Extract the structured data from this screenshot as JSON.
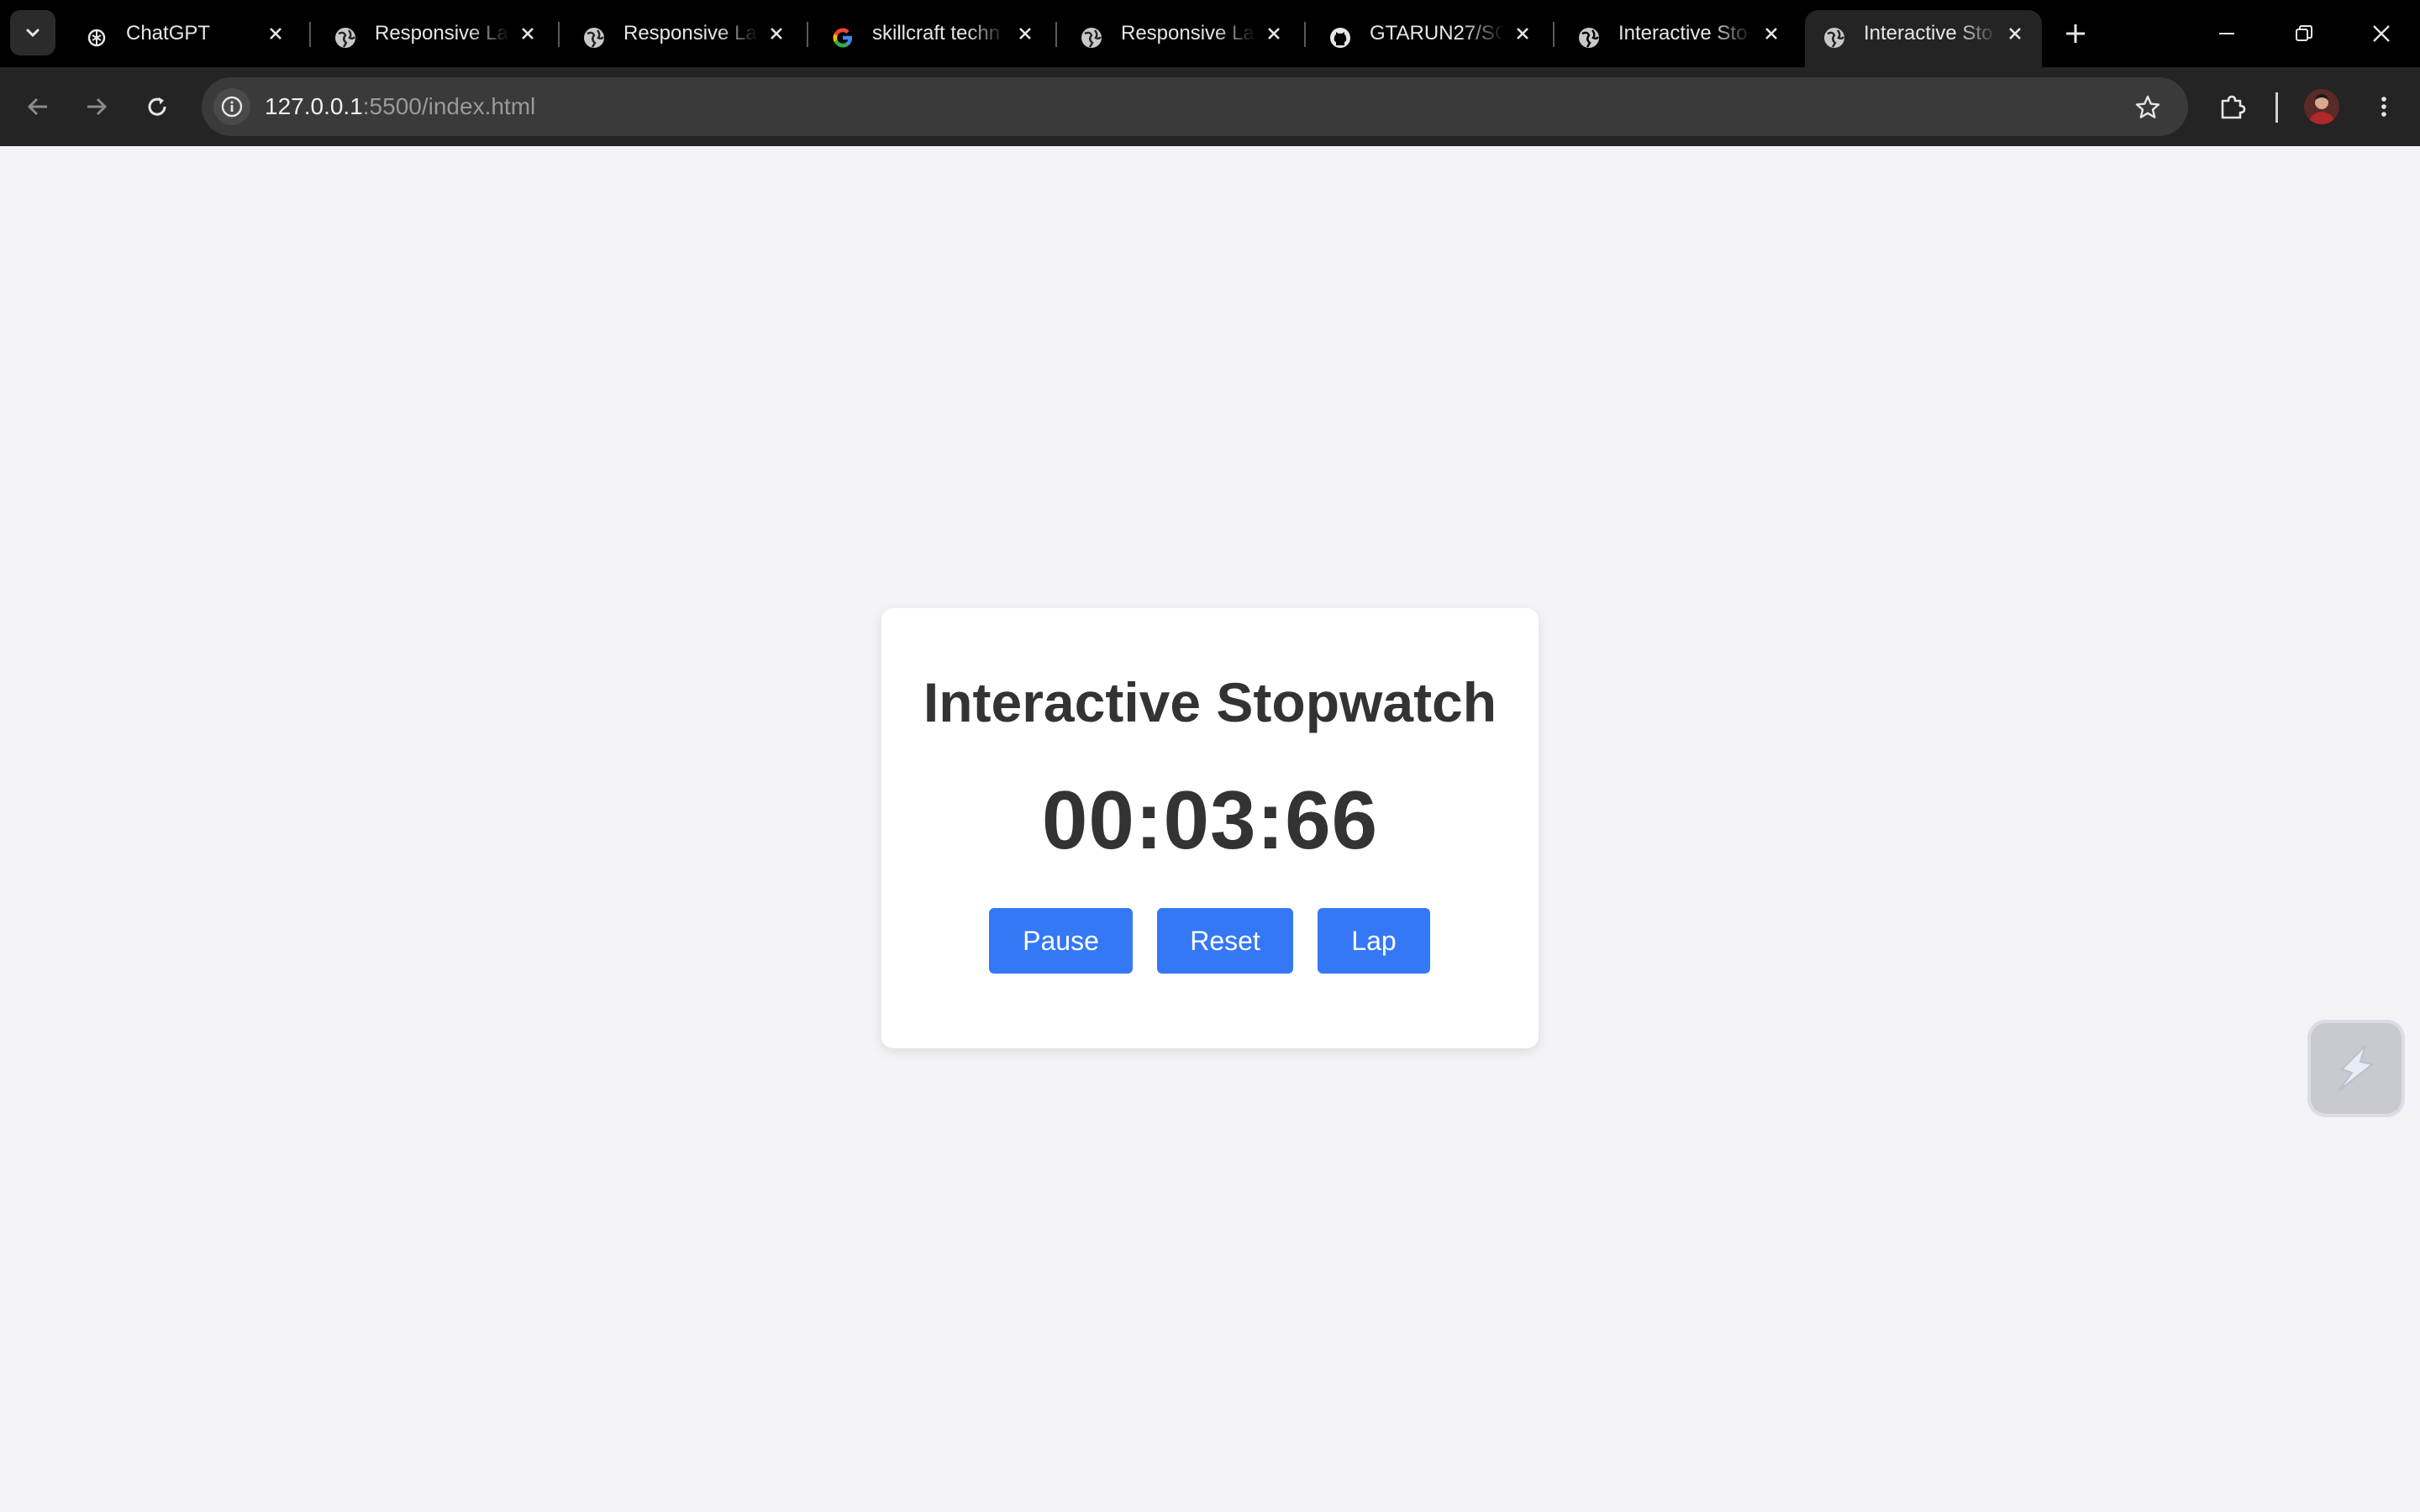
{
  "browser": {
    "tabs": [
      {
        "title": "ChatGPT",
        "icon": "chatgpt-icon",
        "active": false
      },
      {
        "title": "Responsive Lan",
        "icon": "globe-icon",
        "active": false
      },
      {
        "title": "Responsive Lan",
        "icon": "globe-icon",
        "active": false
      },
      {
        "title": "skillcraft techn",
        "icon": "google-icon",
        "active": false
      },
      {
        "title": "Responsive Lan",
        "icon": "globe-icon",
        "active": false
      },
      {
        "title": "GTARUN27/SC",
        "icon": "github-icon",
        "active": false
      },
      {
        "title": "Interactive Sto",
        "icon": "globe-icon",
        "active": false
      },
      {
        "title": "Interactive Sto",
        "icon": "globe-icon",
        "active": true
      }
    ],
    "address": {
      "host": "127.0.0.1",
      "rest": ":5500/index.html"
    }
  },
  "stopwatch": {
    "title": "Interactive Stopwatch",
    "time": "00:03:66",
    "buttons": {
      "pause": "Pause",
      "reset": "Reset",
      "lap": "Lap"
    }
  },
  "colors": {
    "page_background": "#f4f4f8",
    "button": "#3478f6",
    "text": "#333333"
  }
}
